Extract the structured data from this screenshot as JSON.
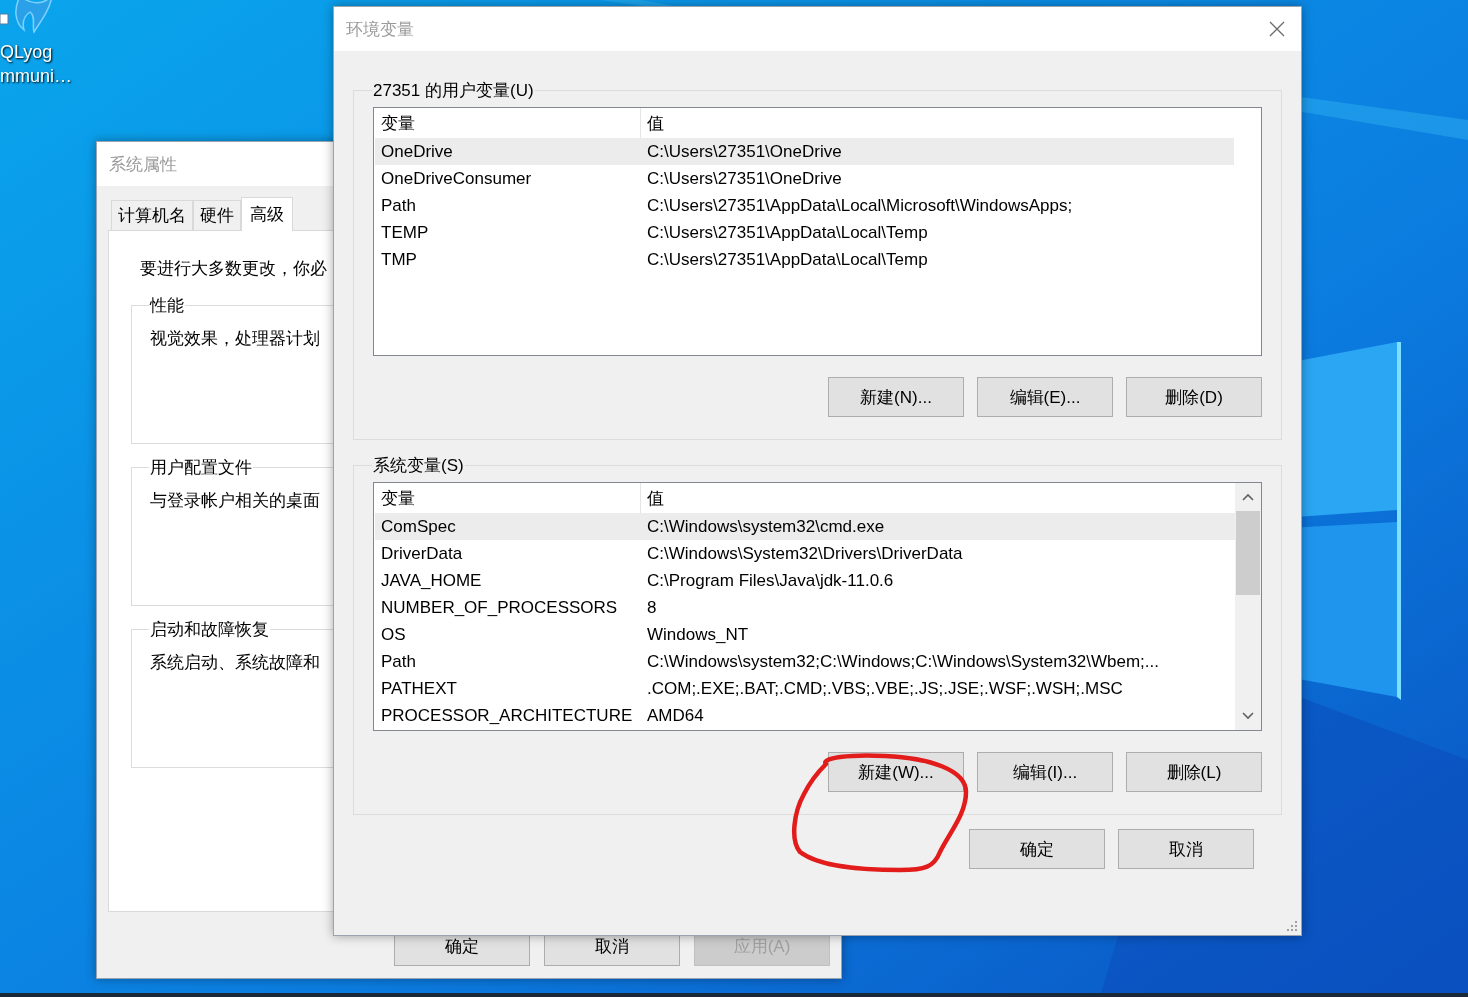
{
  "desktop": {
    "icons": [
      {
        "label_lines": [
          "QLyog",
          "mmuni…"
        ]
      }
    ]
  },
  "system_properties": {
    "title": "系统属性",
    "tabs": [
      {
        "label": "计算机名",
        "selected": false
      },
      {
        "label": "硬件",
        "selected": false
      },
      {
        "label": "高级",
        "selected": true
      }
    ],
    "note": "要进行大多数更改，你必",
    "groups": [
      {
        "title": "性能",
        "text": "视觉效果，处理器计划"
      },
      {
        "title": "用户配置文件",
        "text": "与登录帐户相关的桌面"
      },
      {
        "title": "启动和故障恢复",
        "text": "系统启动、系统故障和"
      }
    ],
    "buttons": [
      {
        "label": "确定",
        "disabled": false
      },
      {
        "label": "取消",
        "disabled": false
      },
      {
        "label": "应用(A)",
        "disabled": true
      }
    ]
  },
  "environment_variables": {
    "title": "环境变量",
    "sections": [
      {
        "title": "27351 的用户变量(U)",
        "columns": [
          "变量",
          "值"
        ],
        "scrollbar": false,
        "rows": [
          {
            "name": "OneDrive",
            "value": "C:\\Users\\27351\\OneDrive",
            "selected": true
          },
          {
            "name": "OneDriveConsumer",
            "value": "C:\\Users\\27351\\OneDrive",
            "selected": false
          },
          {
            "name": "Path",
            "value": "C:\\Users\\27351\\AppData\\Local\\Microsoft\\WindowsApps;",
            "selected": false
          },
          {
            "name": "TEMP",
            "value": "C:\\Users\\27351\\AppData\\Local\\Temp",
            "selected": false
          },
          {
            "name": "TMP",
            "value": "C:\\Users\\27351\\AppData\\Local\\Temp",
            "selected": false
          }
        ],
        "buttons": [
          "新建(N)...",
          "编辑(E)...",
          "删除(D)"
        ]
      },
      {
        "title": "系统变量(S)",
        "columns": [
          "变量",
          "值"
        ],
        "scrollbar": true,
        "rows": [
          {
            "name": "ComSpec",
            "value": "C:\\Windows\\system32\\cmd.exe",
            "selected": true
          },
          {
            "name": "DriverData",
            "value": "C:\\Windows\\System32\\Drivers\\DriverData",
            "selected": false
          },
          {
            "name": "JAVA_HOME",
            "value": "C:\\Program Files\\Java\\jdk-11.0.6",
            "selected": false
          },
          {
            "name": "NUMBER_OF_PROCESSORS",
            "value": "8",
            "selected": false
          },
          {
            "name": "OS",
            "value": "Windows_NT",
            "selected": false
          },
          {
            "name": "Path",
            "value": "C:\\Windows\\system32;C:\\Windows;C:\\Windows\\System32\\Wbem;...",
            "selected": false
          },
          {
            "name": "PATHEXT",
            "value": ".COM;.EXE;.BAT;.CMD;.VBS;.VBE;.JS;.JSE;.WSF;.WSH;.MSC",
            "selected": false
          },
          {
            "name": "PROCESSOR_ARCHITECTURE",
            "value": "AMD64",
            "selected": false
          }
        ],
        "buttons": [
          "新建(W)...",
          "编辑(I)...",
          "删除(L)"
        ]
      }
    ],
    "buttons": [
      "确定",
      "取消"
    ]
  }
}
